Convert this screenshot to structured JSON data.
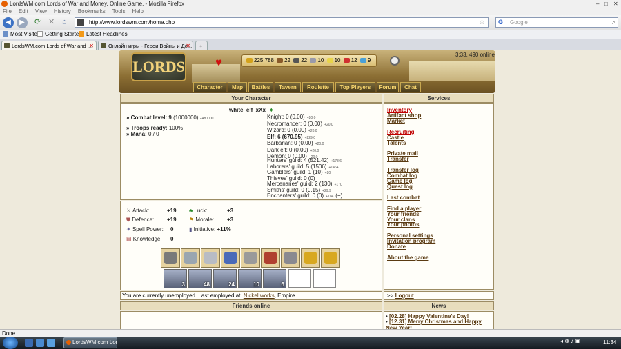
{
  "browser": {
    "title": "LordsWM.com Lords of War and Money. Online Game. - Mozilla Firefox",
    "menu": [
      "File",
      "Edit",
      "View",
      "History",
      "Bookmarks",
      "Tools",
      "Help"
    ],
    "url": "http://www.lordswm.com/home.php",
    "search_placeholder": "Google",
    "bookmarks": [
      "Most Visited",
      "Getting Started",
      "Latest Headlines"
    ],
    "tabs": [
      "LordsWM.com Lords of War and ...",
      "Онлайн игры - Герои Войны и Де..."
    ],
    "status": "Done"
  },
  "game": {
    "resources": {
      "gold": "225,788",
      "wood": "22",
      "ore": "22",
      "mercury": "10",
      "sulfur": "10",
      "crystals": "12",
      "gems": "9"
    },
    "time_online": "3:33, 490 online",
    "logo": "LORDS",
    "nav": [
      "Character",
      "Map",
      "Battles",
      "Tavern",
      "Roulette",
      "Top Players",
      "Forum",
      "Chat"
    ]
  },
  "character": {
    "panel_title": "Your Character",
    "name": "white_elf_xXx",
    "combat_level_label": "» Combat level:",
    "combat_level": "9",
    "combat_level_exp": "(1000000)",
    "combat_level_small": "+480000",
    "troops_ready_label": "» Troops ready:",
    "troops_ready": "100%",
    "mana_label": "» Mana:",
    "mana": "0 / 0",
    "factions": [
      {
        "name": "Knight: 0 (0.00)",
        "bonus": "+20.0"
      },
      {
        "name": "Necromancer: 0 (0.00)",
        "bonus": "+20.0"
      },
      {
        "name": "Wizard: 0 (0.00)",
        "bonus": "+20.0"
      },
      {
        "name": "Elf: 6 (670.95)",
        "bonus": "+229.0"
      },
      {
        "name": "Barbarian: 0 (0.00)",
        "bonus": "+20.0"
      },
      {
        "name": "Dark elf: 0 (0.00)",
        "bonus": "+20.0"
      },
      {
        "name": "Demon: 0 (0.00)",
        "bonus": "+20.0"
      }
    ],
    "guilds": [
      {
        "name": "Hunters' guild: 4 (521.42)",
        "bonus": "+178.6"
      },
      {
        "name": "Laborers' guild: 5 (1506)",
        "bonus": "+1464"
      },
      {
        "name": "Gamblers' guild: 1 (10)",
        "bonus": "+20"
      },
      {
        "name": "Thieves' guild: 0 (0)",
        "bonus": ""
      },
      {
        "name": "Mercenaries' guild: 2 (130)",
        "bonus": "+170"
      },
      {
        "name": "Smiths' guild: 0 (0.15)",
        "bonus": "+29.9"
      },
      {
        "name": "Enchanters' guild: 0 (0)",
        "bonus": "+104"
      }
    ],
    "enchanters_plus": "(+)",
    "stats": {
      "attack_label": "Attack:",
      "attack": "+19",
      "defence_label": "Defence:",
      "defence": "+19",
      "spell_power_label": "Spell Power:",
      "spell_power": "0",
      "knowledge_label": "Knowledge:",
      "knowledge": "0",
      "luck_label": "Luck:",
      "luck": "+3",
      "morale_label": "Morale:",
      "morale": "+3",
      "initiative_label": "Initiative:",
      "initiative": "+11%"
    },
    "equipment": [
      "helmet-icon",
      "amulet-icon",
      "armor-icon",
      "cloak-icon",
      "spear-icon",
      "shield-icon",
      "boots-icon",
      "ring-icon",
      "ring-icon"
    ],
    "troops": [
      "3",
      "48",
      "24",
      "10",
      "6",
      "",
      ""
    ],
    "employment_text": "You are currently unemployed. Last employed at:",
    "employment_link": "Nickel works",
    "employment_place": ", Empire."
  },
  "services": {
    "panel_title": "Services",
    "groups": [
      [
        {
          "label": "Inventory",
          "red": true
        },
        {
          "label": "Artifact shop"
        },
        {
          "label": "Market"
        }
      ],
      [
        {
          "label": "Recruiting",
          "red": true
        },
        {
          "label": "Castle"
        },
        {
          "label": "Talents"
        }
      ],
      [
        {
          "label": "Private mail"
        },
        {
          "label": "Transfer"
        }
      ],
      [
        {
          "label": "Transfer log"
        },
        {
          "label": "Combat log"
        },
        {
          "label": "Game log"
        },
        {
          "label": "Quest log"
        }
      ],
      [
        {
          "label": "Last combat"
        }
      ],
      [
        {
          "label": "Find a player"
        },
        {
          "label": "Your friends"
        },
        {
          "label": "Your clans"
        },
        {
          "label": "Your photos"
        }
      ],
      [
        {
          "label": "Personal settings"
        },
        {
          "label": "Invitation program"
        },
        {
          "label": "Donate"
        }
      ],
      [
        {
          "label": "About the game"
        }
      ]
    ],
    "logout_prefix": ">>",
    "logout": "Logout"
  },
  "friends": {
    "panel_title": "Friends online"
  },
  "news": {
    "panel_title": "News",
    "items": [
      "[02.28] Happy Valentine's Day!",
      "[12.31] Merry Christmas and Happy New Year!"
    ]
  },
  "taskbar": {
    "task": "LordsWM.com Lord...",
    "clock": "11:34"
  }
}
